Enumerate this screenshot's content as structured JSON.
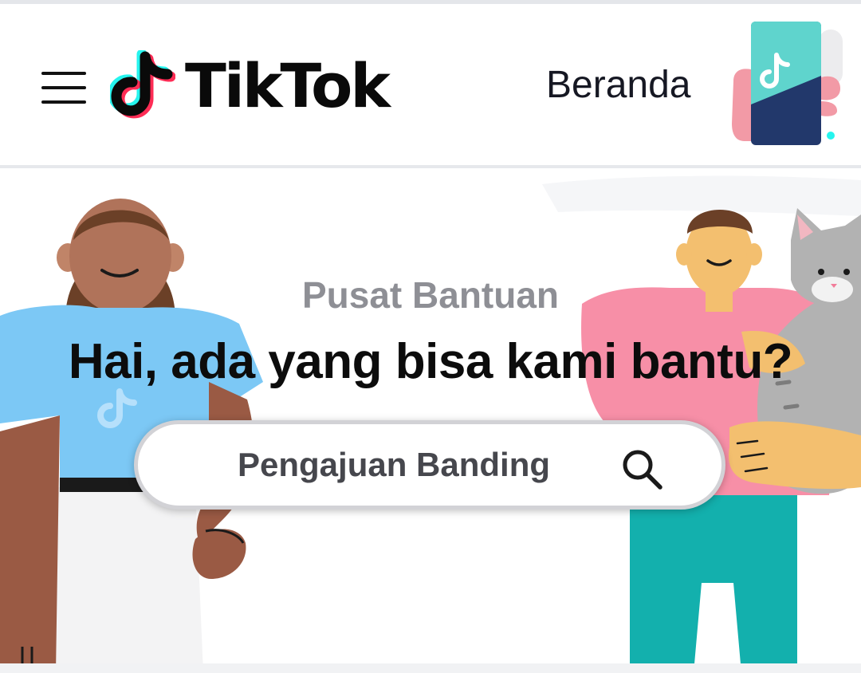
{
  "header": {
    "menu_icon": "hamburger-menu-icon",
    "logo_text": "TikTok",
    "logo_icon": "tiktok-note-icon",
    "nav_home": "Beranda",
    "promo_icon": "tiktok-app-phone-icon"
  },
  "hero": {
    "subtitle": "Pusat Bantuan",
    "title": "Hai, ada yang bisa kami bantu?"
  },
  "search": {
    "value": "Pengajuan Banding",
    "icon": "search-icon"
  },
  "colors": {
    "teal": "#25f4ee",
    "red": "#fe2c55",
    "shirt_blue": "#7cc8f5",
    "shirt_pink": "#f78fa7",
    "pants_teal": "#13b0ad",
    "text_dark": "#161823",
    "text_gray": "#8e8f95"
  }
}
